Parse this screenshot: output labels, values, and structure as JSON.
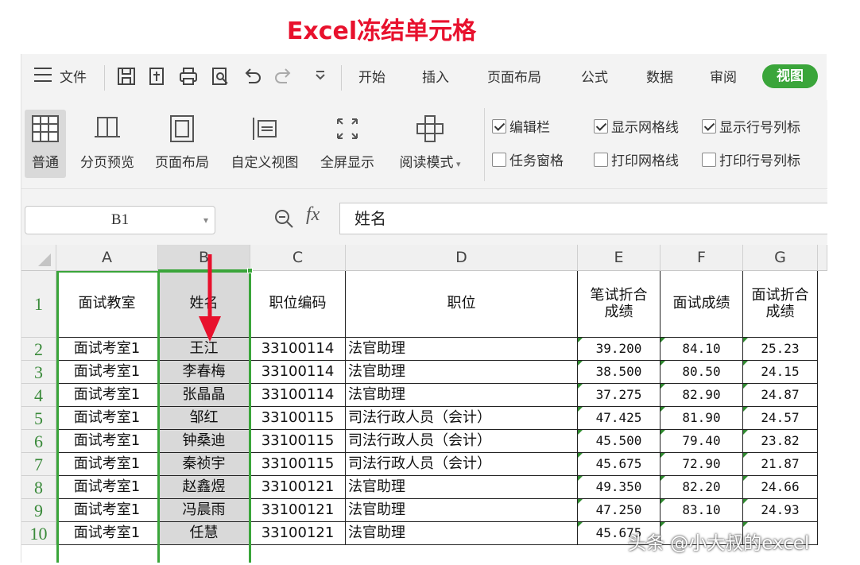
{
  "title": "Excel冻结单元格",
  "menubar": {
    "file_label": "文件",
    "tabs": [
      "开始",
      "插入",
      "页面布局",
      "公式",
      "数据",
      "审阅"
    ],
    "active_tab": "视图"
  },
  "ribbon": {
    "buttons": [
      "普通",
      "分页预览",
      "页面布局",
      "自定义视图",
      "全屏显示",
      "阅读模式"
    ],
    "checkboxes": [
      {
        "label": "编辑栏",
        "checked": true
      },
      {
        "label": "显示网格线",
        "checked": true
      },
      {
        "label": "显示行号列标",
        "checked": true
      },
      {
        "label": "任务窗格",
        "checked": false
      },
      {
        "label": "打印网格线",
        "checked": false
      },
      {
        "label": "打印行号列标",
        "checked": false
      }
    ]
  },
  "formula_bar": {
    "name_box": "B1",
    "fx": "fx",
    "content": "姓名"
  },
  "sheet": {
    "columns": [
      "A",
      "B",
      "C",
      "D",
      "E",
      "F",
      "G"
    ],
    "selected_column": "B",
    "headers": [
      "面试教室",
      "姓名",
      "职位编码",
      "职位",
      "笔试折合\n成绩",
      "面试成绩",
      "面试折合\n成绩"
    ],
    "rows": [
      {
        "n": "2",
        "cells": [
          "面试考室1",
          "王江",
          "33100114",
          "法官助理",
          "39.200",
          "84.10",
          "25.23"
        ]
      },
      {
        "n": "3",
        "cells": [
          "面试考室1",
          "李春梅",
          "33100114",
          "法官助理",
          "38.500",
          "80.50",
          "24.15"
        ]
      },
      {
        "n": "4",
        "cells": [
          "面试考室1",
          "张晶晶",
          "33100114",
          "法官助理",
          "37.275",
          "82.90",
          "24.87"
        ]
      },
      {
        "n": "5",
        "cells": [
          "面试考室1",
          "邹红",
          "33100115",
          "司法行政人员（会计）",
          "47.425",
          "81.90",
          "24.57"
        ]
      },
      {
        "n": "6",
        "cells": [
          "面试考室1",
          "钟桑迪",
          "33100115",
          "司法行政人员（会计）",
          "45.500",
          "79.40",
          "23.82"
        ]
      },
      {
        "n": "7",
        "cells": [
          "面试考室1",
          "秦祯宇",
          "33100115",
          "司法行政人员（会计）",
          "45.675",
          "72.90",
          "21.87"
        ]
      },
      {
        "n": "8",
        "cells": [
          "面试考室1",
          "赵鑫煜",
          "33100121",
          "法官助理",
          "49.350",
          "82.20",
          "24.66"
        ]
      },
      {
        "n": "9",
        "cells": [
          "面试考室1",
          "冯晨雨",
          "33100121",
          "法官助理",
          "47.250",
          "83.10",
          "24.93"
        ]
      },
      {
        "n": "10",
        "cells": [
          "面试考室1",
          "任慧",
          "33100121",
          "法官助理",
          "45.675",
          "",
          ""
        ]
      }
    ],
    "header_row_num": "1"
  },
  "watermark": "头条 @小大叔的excel",
  "colors": {
    "accent": "#3aa53a",
    "title": "#e8112d",
    "arrow": "#e8112d"
  }
}
